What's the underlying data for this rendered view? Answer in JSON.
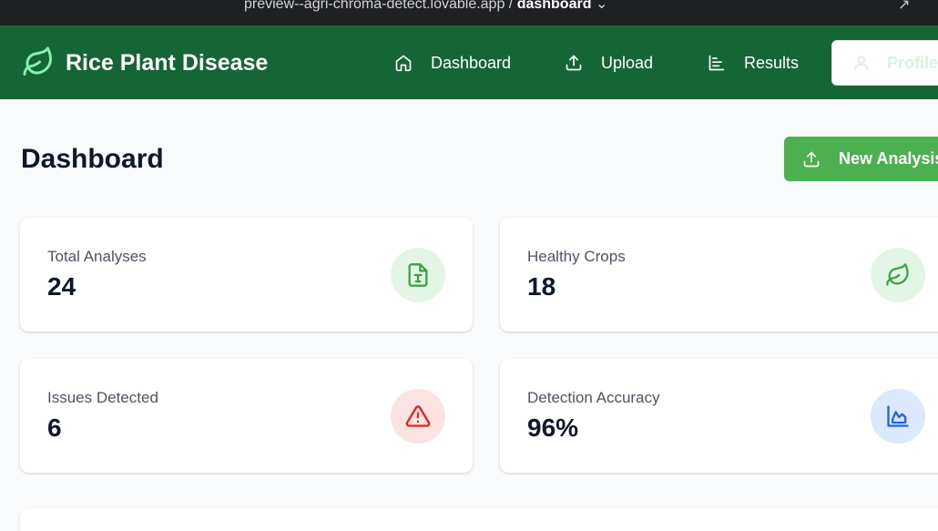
{
  "browser": {
    "url_prefix": "preview--agri-chroma-detect.lovable.app / ",
    "url_page": "dashboard",
    "url_chevron": "⌄",
    "share_icon": "↗"
  },
  "brand": {
    "title": "Rice Plant Disease",
    "icon": "leaf-icon"
  },
  "nav": {
    "items": [
      {
        "label": "Dashboard",
        "icon": "home-icon"
      },
      {
        "label": "Upload",
        "icon": "upload-icon"
      },
      {
        "label": "Results",
        "icon": "bar-chart-icon"
      }
    ],
    "profile_label": "Profile"
  },
  "page": {
    "title": "Dashboard",
    "new_analysis_label": "New Analysis"
  },
  "stats": [
    {
      "label": "Total Analyses",
      "value": "24",
      "icon": "file-text-icon",
      "icon_bg": "#e3f6e6",
      "icon_color": "#43a047"
    },
    {
      "label": "Healthy Crops",
      "value": "18",
      "icon": "leaf-icon",
      "icon_bg": "#e3f6e6",
      "icon_color": "#43a047"
    },
    {
      "label": "Issues Detected",
      "value": "6",
      "icon": "alert-triangle-icon",
      "icon_bg": "#fde2e2",
      "icon_color": "#dc2626"
    },
    {
      "label": "Detection Accuracy",
      "value": "96%",
      "icon": "chart-icon",
      "icon_bg": "#dbe8fd",
      "icon_color": "#2563eb"
    }
  ],
  "colors": {
    "nav_bg": "#166534",
    "accent": "#4caf50"
  }
}
